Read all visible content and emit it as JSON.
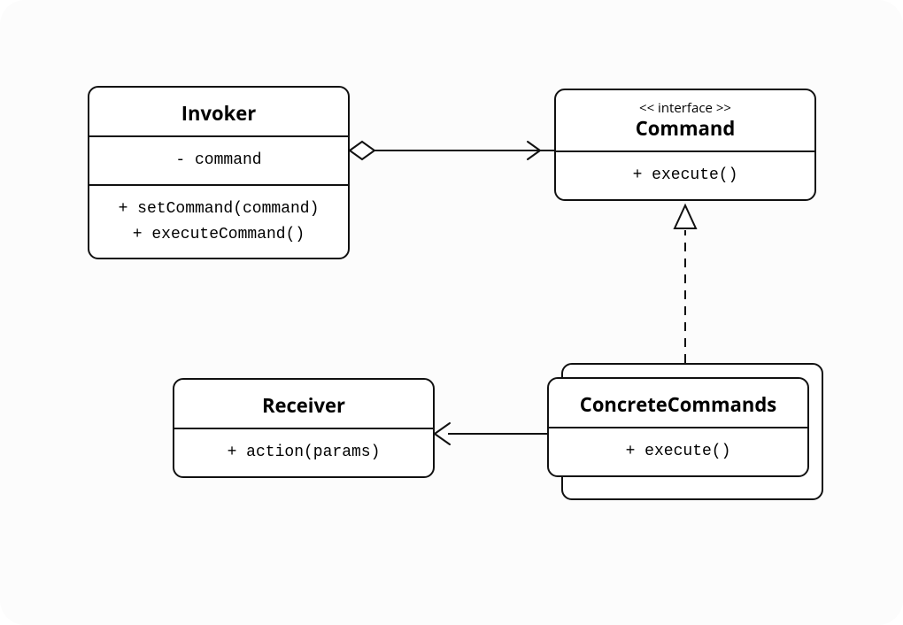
{
  "diagram": {
    "invoker": {
      "title": "Invoker",
      "attr": "- command",
      "op1": "+ setCommand(command)",
      "op2": "+ executeCommand()"
    },
    "command": {
      "stereo": "<< interface >>",
      "title": "Command",
      "op": "+ execute()"
    },
    "receiver": {
      "title": "Receiver",
      "op": "+ action(params)"
    },
    "concrete": {
      "title": "ConcreteCommands",
      "op": "+ execute()"
    }
  }
}
